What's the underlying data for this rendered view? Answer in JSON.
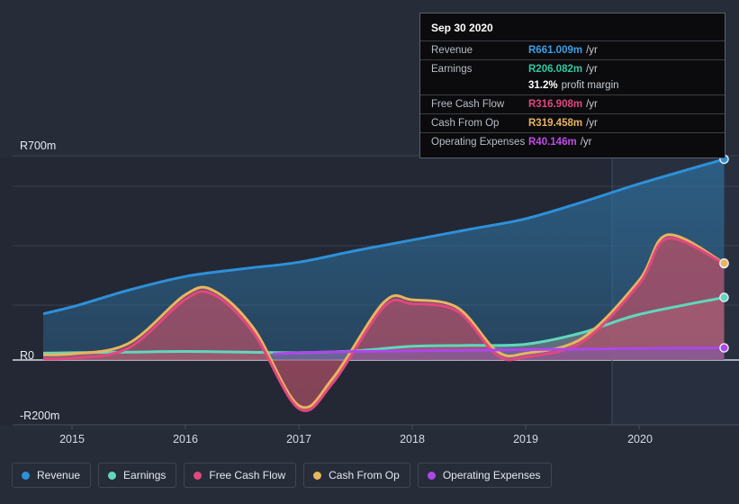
{
  "chart_data": {
    "type": "area",
    "title": "",
    "xlabel": "",
    "ylabel": "",
    "currency_prefix": "R",
    "unit_suffix": "m",
    "ylim": [
      -200,
      700
    ],
    "y_ticks": [
      {
        "label": "R700m",
        "value": 700
      },
      {
        "label": "R0",
        "value": 0
      },
      {
        "label": "-R200m",
        "value": -200
      }
    ],
    "x_ticks": [
      "2015",
      "2016",
      "2017",
      "2018",
      "2019",
      "2020"
    ],
    "grid": true,
    "legend_position": "bottom",
    "series": [
      {
        "name": "Revenue",
        "color": "#2e90d9",
        "x": [
          2014.6,
          2015.0,
          2015.5,
          2016.0,
          2016.5,
          2017.0,
          2017.5,
          2018.0,
          2018.5,
          2019.0,
          2019.5,
          2020.0,
          2020.75
        ],
        "values": [
          140,
          175,
          230,
          275,
          300,
          322,
          360,
          395,
          430,
          465,
          520,
          580,
          661
        ]
      },
      {
        "name": "Earnings",
        "color": "#5fd8bd",
        "x": [
          2014.6,
          2015.0,
          2015.5,
          2016.0,
          2016.5,
          2017.0,
          2017.5,
          2018.0,
          2018.5,
          2019.0,
          2019.5,
          2020.0,
          2020.75
        ],
        "values": [
          22,
          24,
          26,
          28,
          26,
          24,
          30,
          45,
          48,
          52,
          90,
          150,
          206
        ]
      },
      {
        "name": "Free Cash Flow",
        "color": "#e0487e",
        "x": [
          2014.6,
          2015.0,
          2015.5,
          2016.0,
          2016.25,
          2016.6,
          2017.0,
          2017.3,
          2017.75,
          2018.0,
          2018.4,
          2018.75,
          2019.0,
          2019.5,
          2020.0,
          2020.25,
          2020.75
        ],
        "values": [
          5,
          6,
          40,
          200,
          215,
          90,
          -160,
          -75,
          175,
          185,
          160,
          15,
          10,
          60,
          250,
          400,
          317
        ]
      },
      {
        "name": "Cash From Op",
        "color": "#e9b45e",
        "x": [
          2014.6,
          2015.0,
          2015.5,
          2016.0,
          2016.25,
          2016.6,
          2017.0,
          2017.3,
          2017.75,
          2018.0,
          2018.4,
          2018.75,
          2019.0,
          2019.5,
          2020.0,
          2020.25,
          2020.75
        ],
        "values": [
          18,
          20,
          55,
          215,
          228,
          105,
          -150,
          -60,
          190,
          198,
          172,
          28,
          22,
          72,
          262,
          412,
          319
        ]
      },
      {
        "name": "Operating Expenses",
        "color": "#ad47e8",
        "x": [
          2016.78,
          2017.0,
          2017.5,
          2018.0,
          2018.5,
          2019.0,
          2019.5,
          2020.0,
          2020.75
        ],
        "values": [
          20,
          24,
          28,
          30,
          32,
          34,
          36,
          38,
          40
        ]
      }
    ]
  },
  "tooltip": {
    "date": "Sep 30 2020",
    "rows": [
      {
        "name": "Revenue",
        "value": "R661.009m",
        "unit": "/yr",
        "color": "#3d9fe6"
      },
      {
        "name": "Earnings",
        "value": "R206.082m",
        "unit": "/yr",
        "color": "#2fc9a3"
      },
      {
        "name": "",
        "value": "31.2%",
        "unit": "profit margin",
        "color": "#ffffff"
      },
      {
        "name": "Free Cash Flow",
        "value": "R316.908m",
        "unit": "/yr",
        "color": "#e0487e"
      },
      {
        "name": "Cash From Op",
        "value": "R319.458m",
        "unit": "/yr",
        "color": "#e9b45e"
      },
      {
        "name": "Operating Expenses",
        "value": "R40.146m",
        "unit": "/yr",
        "color": "#c14be8"
      }
    ]
  },
  "legend": {
    "items": [
      {
        "label": "Revenue",
        "color": "#2e90d9"
      },
      {
        "label": "Earnings",
        "color": "#5fd8bd"
      },
      {
        "label": "Free Cash Flow",
        "color": "#e0487e"
      },
      {
        "label": "Cash From Op",
        "color": "#e9b45e"
      },
      {
        "label": "Operating Expenses",
        "color": "#ad47e8"
      }
    ]
  },
  "axes": {
    "y_top_label": "R700m",
    "y_zero_label": "R0",
    "y_bottom_label": "-R200m",
    "x_labels": [
      "2015",
      "2016",
      "2017",
      "2018",
      "2019",
      "2020"
    ]
  }
}
